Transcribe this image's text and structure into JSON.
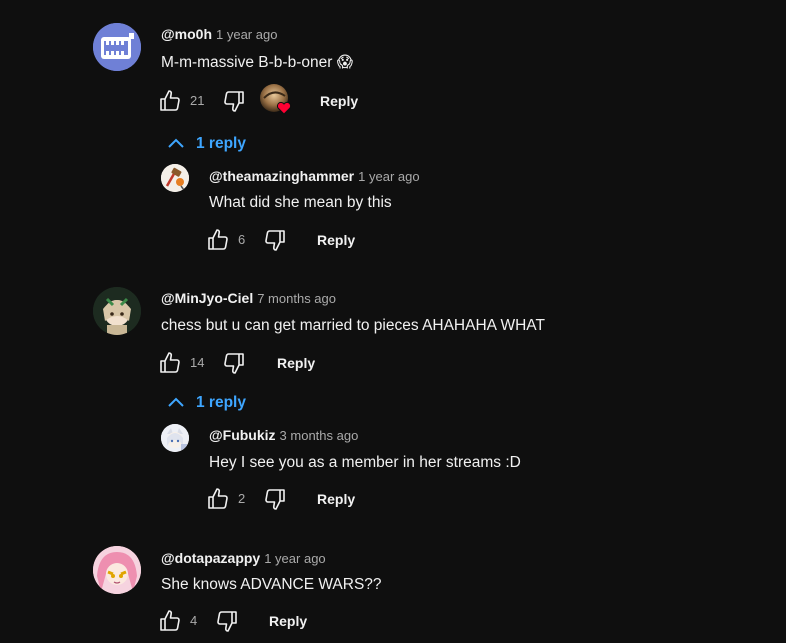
{
  "comments": [
    {
      "author": "@mo0h",
      "time": "1 year ago",
      "text": "M-m-massive B-b-b-oner 😱",
      "likes": "21",
      "reply_label": "Reply",
      "creator_heart": true,
      "replies_toggle": "1 reply",
      "replies": [
        {
          "author": "@theamazinghammer",
          "time": "1 year ago",
          "text": "What did she mean by this",
          "likes": "6",
          "reply_label": "Reply"
        }
      ]
    },
    {
      "author": "@MinJyo-Ciel",
      "time": "7 months ago",
      "text": "chess but u can get married to pieces AHAHAHA WHAT",
      "likes": "14",
      "reply_label": "Reply",
      "replies_toggle": "1 reply",
      "replies": [
        {
          "author": "@Fubukiz",
          "time": "3 months ago",
          "text": "Hey I see you as a member in her streams :D",
          "likes": "2",
          "reply_label": "Reply"
        }
      ]
    },
    {
      "author": "@dotapazappy",
      "time": "1 year ago",
      "text": "She knows ADVANCE WARS??",
      "likes": "4",
      "reply_label": "Reply"
    }
  ],
  "colors": {
    "background": "#0f0f0f",
    "link_blue": "#3ea6ff",
    "secondary_text": "#aaaaaa",
    "heart_red": "#ff0033"
  },
  "icons": {
    "like": "thumb-up-outline",
    "dislike": "thumb-down-outline",
    "toggle": "chevron-up",
    "heart": "heart-filled"
  }
}
